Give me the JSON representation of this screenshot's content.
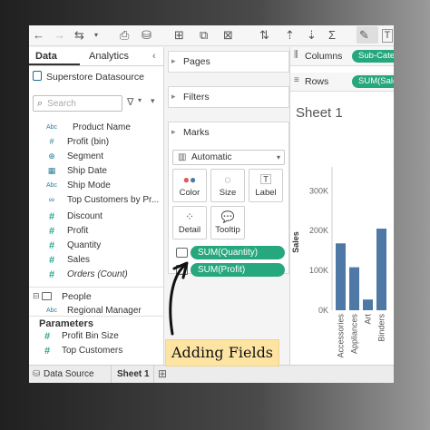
{
  "toolbar": {
    "icons": [
      "back-arrow",
      "forward-arrow",
      "redo",
      "dropdown",
      "save",
      "new-datasource",
      "new-worksheet",
      "duplicate",
      "clear",
      "swap",
      "sort",
      "totals",
      "highlight",
      "text"
    ]
  },
  "left_panel": {
    "tabs": [
      {
        "label": "Data",
        "active": true
      },
      {
        "label": "Analytics",
        "active": false
      }
    ],
    "collapse_glyph": "‹",
    "datasource": "Superstore Datasource",
    "search_placeholder": "Search",
    "fields": [
      {
        "type": "Abc",
        "label": "Product Name",
        "kind": "dimension"
      },
      {
        "type": "#",
        "label": "Profit (bin)",
        "kind": "dimension"
      },
      {
        "type": "⊕",
        "label": "Segment",
        "kind": "dimension"
      },
      {
        "type": "▦",
        "label": "Ship Date",
        "kind": "dimension"
      },
      {
        "type": "Abc",
        "label": "Ship Mode",
        "kind": "dimension"
      },
      {
        "type": "∞",
        "label": "Top Customers by Pr...",
        "kind": "dimension"
      },
      {
        "type": "#",
        "label": "Discount",
        "kind": "measure"
      },
      {
        "type": "#",
        "label": "Profit",
        "kind": "measure"
      },
      {
        "type": "#",
        "label": "Quantity",
        "kind": "measure"
      },
      {
        "type": "#",
        "label": "Sales",
        "kind": "measure"
      },
      {
        "type": "#",
        "label": "Orders (Count)",
        "kind": "measure",
        "italic": true
      }
    ],
    "people_folder": {
      "label": "People",
      "collapse": "⊟",
      "field": {
        "type": "Abc",
        "label": "Regional Manager"
      }
    },
    "parameters_header": "Parameters",
    "parameters": [
      {
        "type": "#",
        "label": "Profit Bin Size"
      },
      {
        "type": "#",
        "label": "Top Customers"
      }
    ]
  },
  "middle_panel": {
    "pages": "Pages",
    "filters": "Filters",
    "marks": {
      "title": "Marks",
      "mark_type": "Automatic",
      "buttons": [
        {
          "label": "Color",
          "icon": "color-icon"
        },
        {
          "label": "Size",
          "icon": "size-icon"
        },
        {
          "label": "Label",
          "icon": "label-icon"
        },
        {
          "label": "Detail",
          "icon": "detail-icon"
        },
        {
          "label": "Tooltip",
          "icon": "tooltip-icon"
        }
      ],
      "pills": [
        "SUM(Quantity)",
        "SUM(Profit)"
      ]
    }
  },
  "canvas": {
    "columns_label": "Columns",
    "columns_pill": "Sub-Category",
    "rows_label": "Rows",
    "rows_pill": "SUM(Sales)",
    "sheet_title": "Sheet 1",
    "chart_data": {
      "type": "bar",
      "ylabel": "Sales",
      "yticks": [
        "300K",
        "200K",
        "100K",
        "0K"
      ],
      "ylim": [
        0,
        360
      ],
      "categories": [
        "Accessories",
        "Appliances",
        "Art",
        "Binders"
      ],
      "values": [
        168,
        108,
        27,
        205
      ],
      "bar_color": "#4e79a7"
    }
  },
  "bottom_bar": {
    "tabs": [
      {
        "label": "Data Source",
        "active": false
      },
      {
        "label": "Sheet 1",
        "active": true
      }
    ]
  },
  "callout": "Adding Fields"
}
